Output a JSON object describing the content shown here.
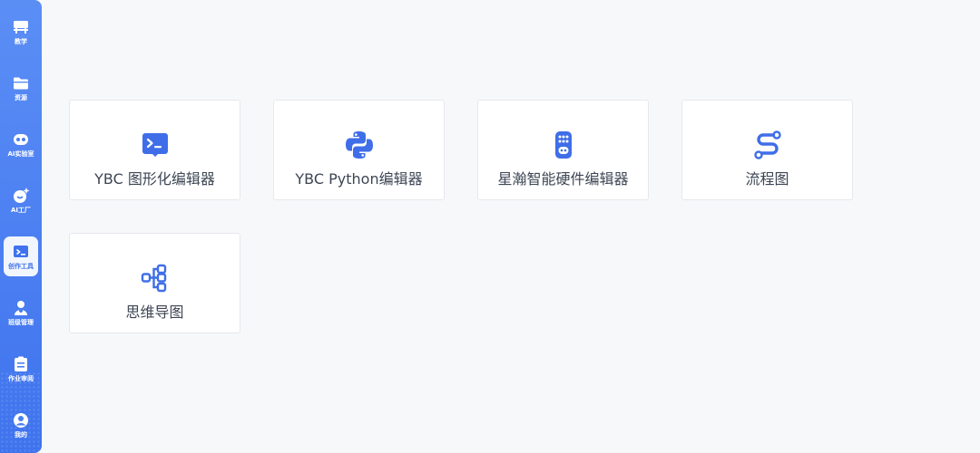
{
  "theme": {
    "sidebar_top": "#5b8ef5",
    "sidebar_bottom": "#3f73ee",
    "accent": "#3f6ee8",
    "background": "#f7f8fa",
    "card_border": "#e6e8ec",
    "text": "#3d4654"
  },
  "sidebar": {
    "items": [
      {
        "label": "教学",
        "icon": "teaching-board-icon",
        "active": false
      },
      {
        "label": "资源",
        "icon": "folder-icon",
        "active": false
      },
      {
        "label": "AI实验室",
        "icon": "robot-icon",
        "active": false
      },
      {
        "label": "AI工厂",
        "icon": "ai-sparkle-icon",
        "active": false
      },
      {
        "label": "创作工具",
        "icon": "code-terminal-icon",
        "active": true
      },
      {
        "label": "班级管理",
        "icon": "class-group-icon",
        "active": false
      },
      {
        "label": "作业审阅",
        "icon": "clipboard-icon",
        "active": false
      },
      {
        "label": "我的",
        "icon": "user-avatar-icon",
        "active": false
      }
    ]
  },
  "tools": [
    {
      "title": "YBC 图形化编辑器",
      "icon": "graphical-editor-icon"
    },
    {
      "title": "YBC Python编辑器",
      "icon": "python-icon"
    },
    {
      "title": "星瀚智能硬件编辑器",
      "icon": "hardware-device-icon"
    },
    {
      "title": "流程图",
      "icon": "flowchart-path-icon"
    },
    {
      "title": "思维导图",
      "icon": "mindmap-icon"
    }
  ]
}
